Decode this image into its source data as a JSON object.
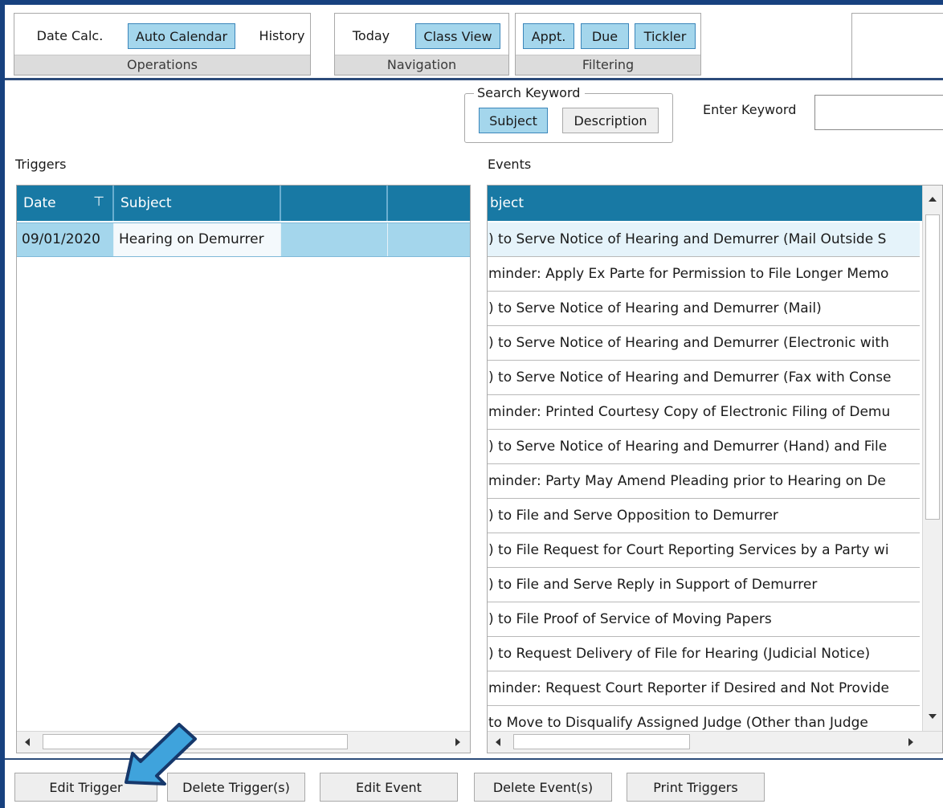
{
  "ribbon": {
    "operations": {
      "label": "Operations",
      "buttons": [
        "Date Calc.",
        "Auto Calendar",
        "History"
      ]
    },
    "navigation": {
      "label": "Navigation",
      "buttons": [
        "Today",
        "Class View"
      ]
    },
    "filtering": {
      "label": "Filtering",
      "buttons": [
        "Appt.",
        "Due",
        "Tickler"
      ]
    }
  },
  "search": {
    "legend": "Search Keyword",
    "subject": "Subject",
    "description": "Description",
    "keyword_label": "Enter Keyword",
    "keyword_value": ""
  },
  "triggers": {
    "label": "Triggers",
    "columns": [
      "Date",
      "Subject",
      "",
      ""
    ],
    "rows": [
      {
        "date": "09/01/2020",
        "subject": "Hearing on Demurrer"
      }
    ]
  },
  "events": {
    "label": "Events",
    "column": "bject",
    "rows": [
      ") to Serve Notice of Hearing and Demurrer (Mail Outside S",
      "minder: Apply Ex Parte for Permission to File Longer Memo",
      ") to Serve Notice of Hearing and Demurrer (Mail)",
      ") to Serve Notice of Hearing and Demurrer (Electronic with",
      ") to Serve Notice of Hearing and Demurrer (Fax with Conse",
      "minder: Printed Courtesy Copy of Electronic Filing of Demu",
      ") to Serve Notice of Hearing and Demurrer (Hand) and File",
      "minder: Party May Amend Pleading prior to Hearing on De",
      ") to File and Serve Opposition to Demurrer",
      ") to File Request for Court Reporting Services by a Party wi",
      ") to File and Serve Reply in Support of Demurrer",
      ") to File Proof of Service of Moving Papers",
      ") to Request Delivery of File for Hearing (Judicial Notice)",
      "minder: Request Court Reporter if Desired and Not Provide",
      "  to Move to Disqualify Assigned Judge (Other than Judge"
    ]
  },
  "buttons": {
    "edit_trigger": "Edit Trigger",
    "delete_triggers": "Delete Trigger(s)",
    "edit_event": "Edit Event",
    "delete_events": "Delete Event(s)",
    "print_triggers": "Print Triggers"
  },
  "colors": {
    "accent": "#1879a4",
    "selected": "#a4d6ec",
    "frame": "#17417f",
    "callout": "#3fa3dc"
  }
}
